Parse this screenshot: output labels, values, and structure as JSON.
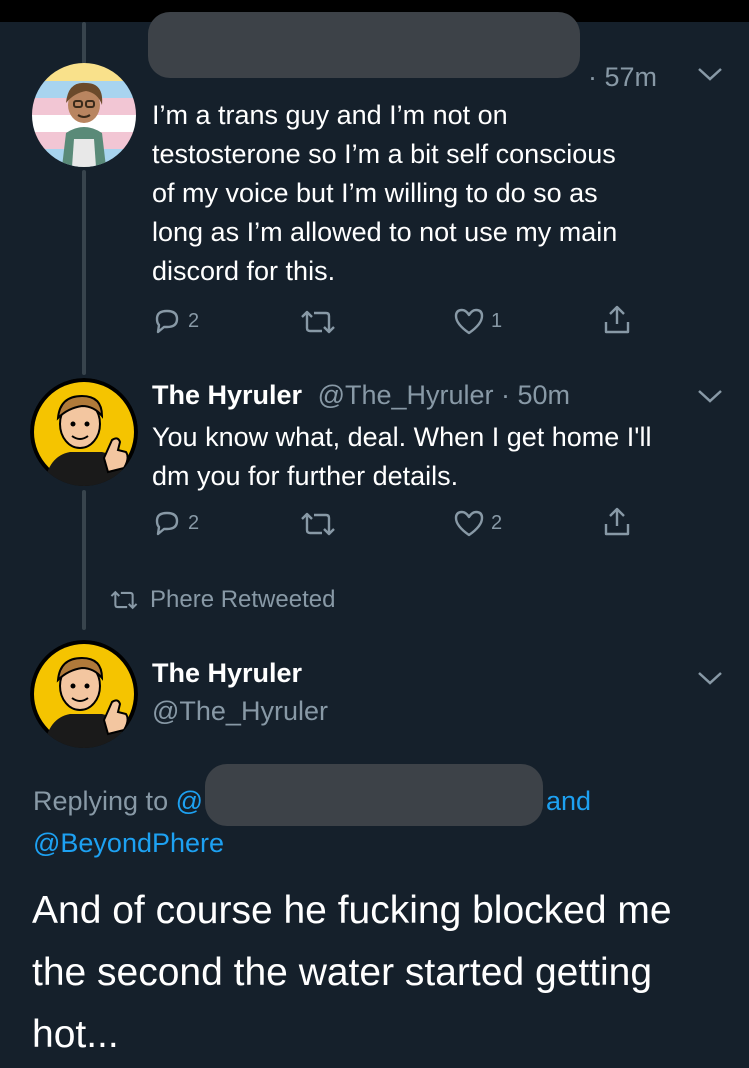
{
  "tweet1": {
    "time": "· 57m",
    "text_lines": [
      "I’m a trans guy and I’m not on",
      "testosterone so I’m a bit self conscious",
      "of my voice but I’m willing to do so as",
      "long as I’m allowed to not use my main",
      "discord for this."
    ],
    "replies": "2",
    "likes": "1",
    "avatar_stripes": [
      "#f9e18b",
      "#a8d4ef",
      "#f2c6d4",
      "#ffffff",
      "#f2c6d4",
      "#a8d4ef"
    ]
  },
  "tweet2": {
    "name": "The Hyruler",
    "handle_time": "@The_Hyruler · 50m",
    "text_lines": [
      "You know what, deal. When I get home I'll",
      "dm you for further details."
    ],
    "replies": "2",
    "likes": "2"
  },
  "retweet_label": "Phere Retweeted",
  "main": {
    "name": "The Hyruler",
    "handle": "@The_Hyruler",
    "replying_prefix": "Replying to",
    "replying_at": "@",
    "replying_and": "and",
    "replying_second": "@BeyondPhere",
    "text_lines": [
      "And of course he fucking blocked me",
      "the second the water started getting",
      "hot..."
    ]
  },
  "colors": {
    "background": "#15202b",
    "muted": "#8899a6",
    "link": "#1da1f2",
    "thread_line": "#38444d",
    "avatar_yellow": "#f5c400"
  },
  "icons": [
    "reply-icon",
    "retweet-icon",
    "like-icon",
    "share-icon",
    "chevron-down-icon"
  ]
}
